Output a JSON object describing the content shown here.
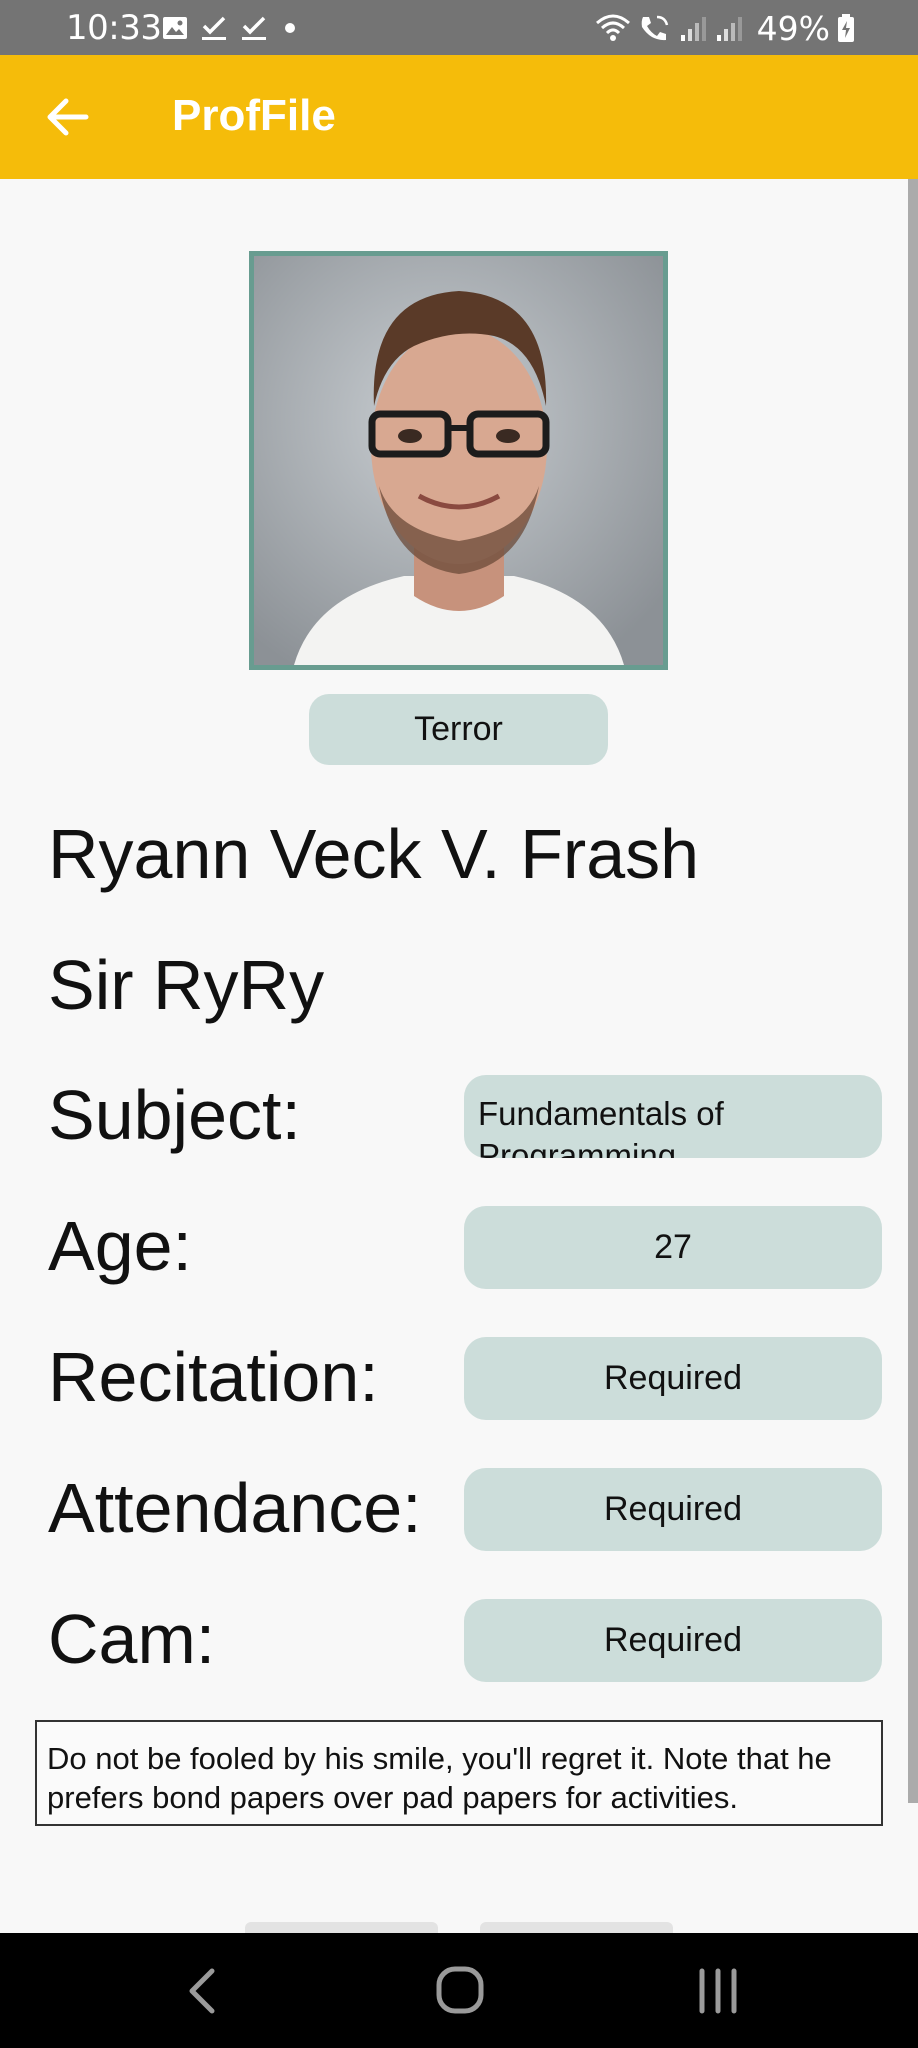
{
  "status_bar": {
    "time": "10:33",
    "battery": "49%",
    "icons": [
      "gallery-icon",
      "check-icon",
      "check-icon",
      "dot-icon",
      "wifi-icon",
      "wifi-call-icon",
      "signal-icon",
      "signal-icon",
      "battery-icon"
    ]
  },
  "app_bar": {
    "title": "ProfFile",
    "color": "#f5bc0a"
  },
  "profile": {
    "title_badge": "Terror",
    "name": "Ryann Veck V. Frash",
    "nickname": "Sir RyRy",
    "fields": {
      "subject": {
        "label": "Subject:",
        "value": "Fundamentals of Programming"
      },
      "age": {
        "label": "Age:",
        "value": "27"
      },
      "recitation": {
        "label": "Recitation:",
        "value": "Required"
      },
      "attendance": {
        "label": "Attendance:",
        "value": "Required"
      },
      "cam": {
        "label": "Cam:",
        "value": "Required"
      }
    },
    "note": "Do not be fooled by his smile, you'll regret it. Note that he prefers bond papers over pad papers for activities."
  },
  "colors": {
    "accent": "#f5bc0a",
    "pill": "#ccddda",
    "photo_border": "#689c90"
  },
  "nav_bar": {
    "icons": [
      "back-icon",
      "home-icon",
      "recents-icon"
    ]
  }
}
